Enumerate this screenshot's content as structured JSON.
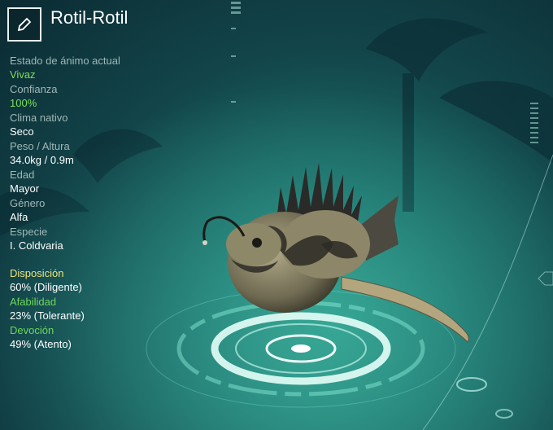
{
  "creature": {
    "name": "Rotil-Rotil",
    "edit_icon": "pencil-icon"
  },
  "stats": [
    {
      "label": "Estado de ánimo actual",
      "value": "Vivaz",
      "value_color": "#7be05a"
    },
    {
      "label": "Confianza",
      "value": "100%",
      "value_color": "#7be05a"
    },
    {
      "label": "Clima nativo",
      "value": "Seco",
      "value_color": "#ffffff"
    },
    {
      "label": "Peso / Altura",
      "value": "34.0kg / 0.9m",
      "value_color": "#ffffff"
    },
    {
      "label": "Edad",
      "value": "Mayor",
      "value_color": "#ffffff"
    },
    {
      "label": "Género",
      "value": "Alfa",
      "value_color": "#ffffff"
    },
    {
      "label": "Especie",
      "value": "I. Coldvaria",
      "value_color": "#ffffff"
    }
  ],
  "personality": [
    {
      "label": "Disposición",
      "value": "60% (Diligente)",
      "label_color": "#e9e27a"
    },
    {
      "label": "Afabilidad",
      "value": "23% (Tolerante)",
      "label_color": "#6fd65a"
    },
    {
      "label": "Devoción",
      "value": "49% (Atento)",
      "label_color": "#6fd65a"
    }
  ]
}
